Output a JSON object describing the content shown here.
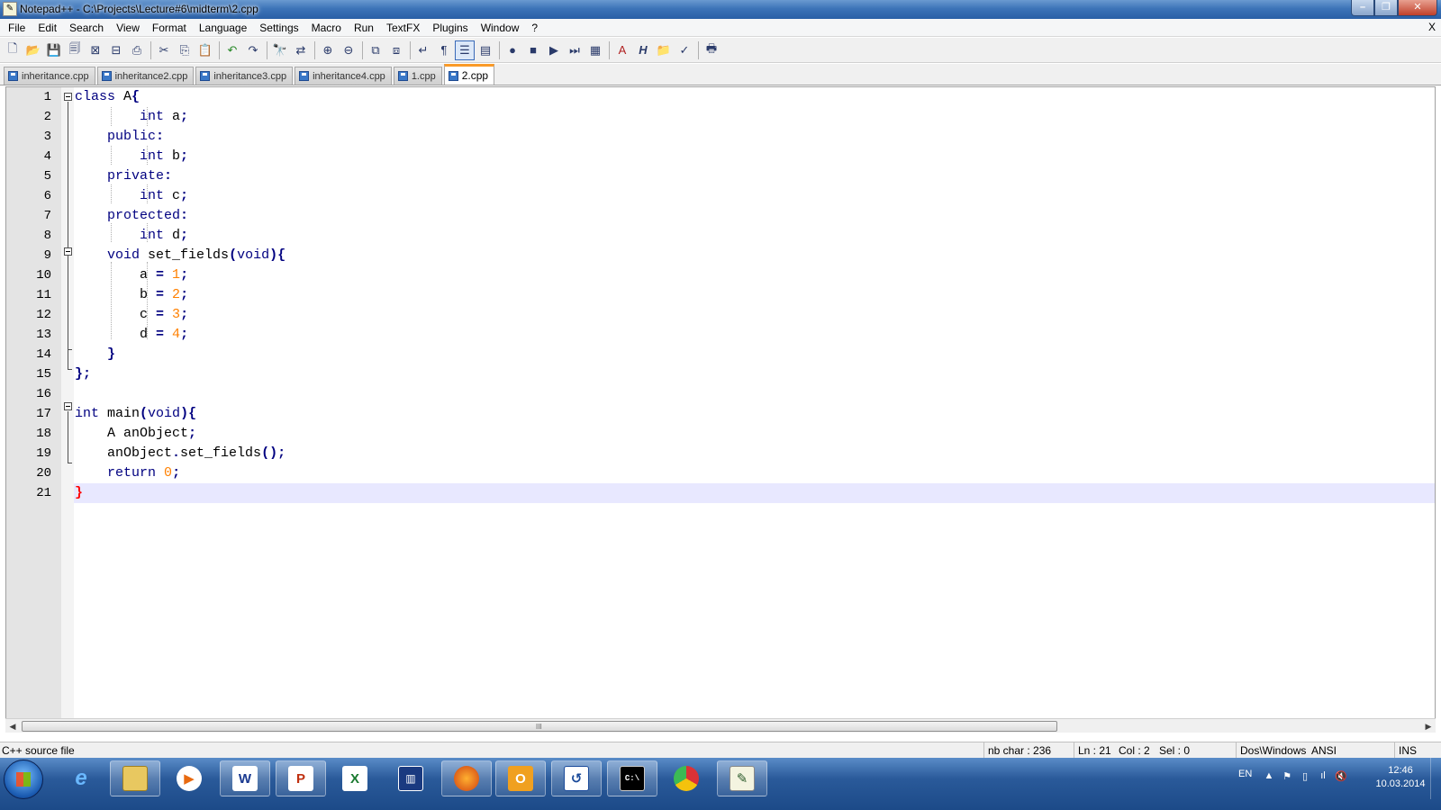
{
  "window": {
    "title": "Notepad++ - C:\\Projects\\Lecture#6\\midterm\\2.cpp",
    "menu_close": "X"
  },
  "menu": [
    "File",
    "Edit",
    "Search",
    "View",
    "Format",
    "Language",
    "Settings",
    "Macro",
    "Run",
    "TextFX",
    "Plugins",
    "Window",
    "?"
  ],
  "tabs": [
    {
      "label": "inheritance.cpp",
      "active": false
    },
    {
      "label": "inheritance2.cpp",
      "active": false
    },
    {
      "label": "inheritance3.cpp",
      "active": false
    },
    {
      "label": "inheritance4.cpp",
      "active": false
    },
    {
      "label": "1.cpp",
      "active": false
    },
    {
      "label": "2.cpp",
      "active": true
    }
  ],
  "editor": {
    "current_line": 21,
    "line_numbers": [
      "1",
      "2",
      "3",
      "4",
      "5",
      "6",
      "7",
      "8",
      "9",
      "10",
      "11",
      "12",
      "13",
      "14",
      "15",
      "16",
      "17",
      "18",
      "19",
      "20",
      "21"
    ],
    "lines": [
      "class A{",
      "        int a;",
      "    public:",
      "        int b;",
      "    private:",
      "        int c;",
      "    protected:",
      "        int d;",
      "    void set_fields(void){",
      "        a = 1;",
      "        b = 2;",
      "        c = 3;",
      "        d = 4;",
      "    }",
      "};",
      "",
      "int main(void){",
      "    A anObject;",
      "    anObject.set_fields();",
      "    return 0;",
      "}"
    ]
  },
  "statusbar": {
    "file_type": "C++ source file",
    "nb_char": "nb char : 236",
    "ln": "Ln : 21",
    "col": "Col : 2",
    "sel": "Sel : 0",
    "eol": "Dos\\Windows",
    "encoding": "ANSI",
    "mode": "INS"
  },
  "taskbar": {
    "lang": "EN",
    "time": "12:46",
    "date": "10.03.2014"
  },
  "colors": {
    "keyword": "#000080",
    "number": "#ff8000",
    "brace_highlight": "#ff0000",
    "current_line_bg": "#e8e8ff",
    "active_tab_accent": "#fa9a28"
  }
}
